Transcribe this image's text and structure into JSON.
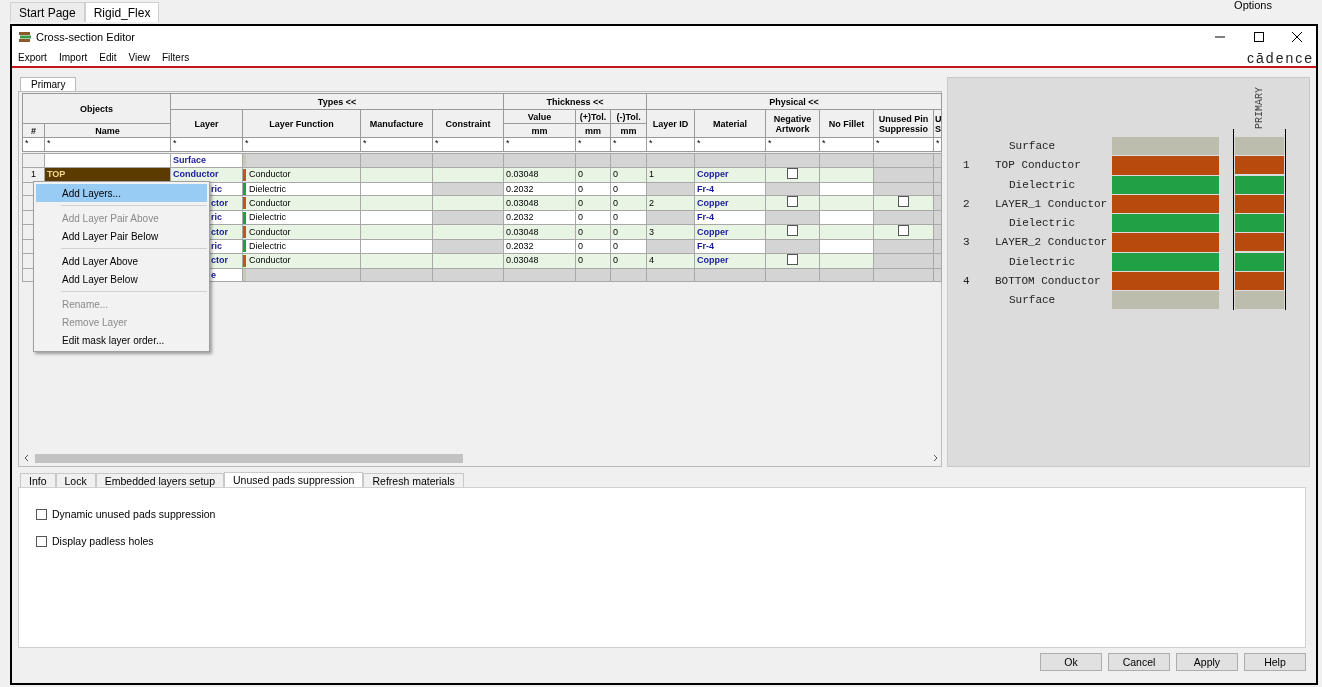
{
  "tab_strip": {
    "tabs": [
      {
        "label": "Start Page",
        "selected": false
      },
      {
        "label": "Rigid_Flex",
        "selected": true
      }
    ],
    "options_label": "Options"
  },
  "window": {
    "title": "Cross-section Editor",
    "logo": "cādence"
  },
  "menu_bar": [
    "Export",
    "Import",
    "Edit",
    "View",
    "Filters"
  ],
  "view_tabs": [
    {
      "label": "Primary",
      "selected": true
    }
  ],
  "table": {
    "groups": [
      {
        "label": "Objects",
        "kind": "tall",
        "columns": [
          {
            "label": "#",
            "filter": "*"
          },
          {
            "label": "Name",
            "filter": "*"
          }
        ]
      },
      {
        "label": "Types <<",
        "kind": "normal",
        "columns": [
          {
            "label": "Layer",
            "filter": "*"
          },
          {
            "label": "Layer Function",
            "filter": "*"
          },
          {
            "label": "Manufacture",
            "filter": "*"
          },
          {
            "label": "Constraint",
            "filter": "*"
          }
        ]
      },
      {
        "label": "Thickness <<",
        "kind": "normal",
        "columns": [
          {
            "label": "Value",
            "unit": "mm",
            "filter": "*"
          },
          {
            "label": "(+)Tol.",
            "unit": "mm",
            "filter": "*"
          },
          {
            "label": "(-)Tol.",
            "unit": "mm",
            "filter": "*"
          }
        ]
      },
      {
        "label": "Physical <<",
        "kind": "normal",
        "columns": [
          {
            "label": "Layer ID",
            "filter": "*"
          },
          {
            "label": "Material",
            "filter": "*"
          },
          {
            "label": "Negative Artwork",
            "filter": "*"
          },
          {
            "label": "No Fillet",
            "filter": "*"
          },
          {
            "label": "Unused Pin Suppressio",
            "filter": "*"
          },
          {
            "label": "U S",
            "filter": "*"
          }
        ]
      }
    ],
    "rows": [
      {
        "kind": "surface",
        "layer": "Surface",
        "color": "#c8c8bc"
      },
      {
        "kind": "conductor",
        "number": "1",
        "name": "TOP",
        "selected": true,
        "layer": "Conductor",
        "function": "Conductor",
        "color": "#c0561a",
        "value": "0.03048",
        "plus_tol": "0",
        "minus_tol": "0",
        "layer_id": "1",
        "material": "Copper",
        "negative_artwork": false
      },
      {
        "kind": "dielectric",
        "layer": "ric",
        "function": "Dielectric",
        "color": "#22a040",
        "value": "0.2032",
        "plus_tol": "0",
        "minus_tol": "0",
        "material": "Fr-4"
      },
      {
        "kind": "conductor",
        "layer": "ctor",
        "function": "Conductor",
        "color": "#c0561a",
        "value": "0.03048",
        "plus_tol": "0",
        "minus_tol": "0",
        "layer_id": "2",
        "material": "Copper",
        "negative_artwork": false,
        "unused_pin_suppression": false
      },
      {
        "kind": "dielectric",
        "layer": "ric",
        "function": "Dielectric",
        "color": "#22a040",
        "value": "0.2032",
        "plus_tol": "0",
        "minus_tol": "0",
        "material": "Fr-4"
      },
      {
        "kind": "conductor",
        "layer": "ctor",
        "function": "Conductor",
        "color": "#c0561a",
        "value": "0.03048",
        "plus_tol": "0",
        "minus_tol": "0",
        "layer_id": "3",
        "material": "Copper",
        "negative_artwork": false,
        "unused_pin_suppression": false
      },
      {
        "kind": "dielectric",
        "layer": "ric",
        "function": "Dielectric",
        "color": "#22a040",
        "value": "0.2032",
        "plus_tol": "0",
        "minus_tol": "0",
        "material": "Fr-4"
      },
      {
        "kind": "conductor",
        "layer": "ctor",
        "function": "Conductor",
        "color": "#c0561a",
        "value": "0.03048",
        "plus_tol": "0",
        "minus_tol": "0",
        "layer_id": "4",
        "material": "Copper",
        "negative_artwork": false
      },
      {
        "kind": "surface",
        "layer": "e",
        "color": "#c8c8bc"
      }
    ]
  },
  "context_menu": [
    {
      "kind": "item",
      "label": "Add Layers...",
      "highlighted": true,
      "disabled": false
    },
    {
      "kind": "separator"
    },
    {
      "kind": "item",
      "label": "Add Layer Pair Above",
      "highlighted": false,
      "disabled": true
    },
    {
      "kind": "item",
      "label": "Add Layer Pair Below",
      "highlighted": false,
      "disabled": false
    },
    {
      "kind": "separator"
    },
    {
      "kind": "item",
      "label": "Add Layer Above",
      "highlighted": false,
      "disabled": false
    },
    {
      "kind": "item",
      "label": "Add Layer Below",
      "highlighted": false,
      "disabled": false
    },
    {
      "kind": "separator"
    },
    {
      "kind": "item",
      "label": "Rename...",
      "highlighted": false,
      "disabled": true
    },
    {
      "kind": "item",
      "label": "Remove Layer",
      "highlighted": false,
      "disabled": true
    },
    {
      "kind": "item",
      "label": "Edit mask layer order...",
      "highlighted": false,
      "disabled": false
    }
  ],
  "stack": {
    "column_label": "PRIMARY",
    "layers": [
      {
        "kind": "surface",
        "label": "Surface",
        "color": "#bdbdad"
      },
      {
        "kind": "conductor",
        "number": "1",
        "label": "TOP Conductor",
        "color": "#b94a0e"
      },
      {
        "kind": "dielectric",
        "label": "Dielectric",
        "color": "#22a045"
      },
      {
        "kind": "conductor",
        "number": "2",
        "label": "LAYER_1 Conductor",
        "color": "#b94a0e"
      },
      {
        "kind": "dielectric",
        "label": "Dielectric",
        "color": "#22a045"
      },
      {
        "kind": "conductor",
        "number": "3",
        "label": "LAYER_2 Conductor",
        "color": "#b94a0e"
      },
      {
        "kind": "dielectric",
        "label": "Dielectric",
        "color": "#22a045"
      },
      {
        "kind": "conductor",
        "number": "4",
        "label": "BOTTOM Conductor",
        "color": "#b94a0e"
      },
      {
        "kind": "surface",
        "label": "Surface",
        "color": "#bdbdad"
      }
    ]
  },
  "bottom_tabs": [
    {
      "label": "Info",
      "selected": false
    },
    {
      "label": "Lock",
      "selected": false
    },
    {
      "label": "Embedded layers setup",
      "selected": false
    },
    {
      "label": "Unused pads suppression",
      "selected": true
    },
    {
      "label": "Refresh materials",
      "selected": false
    }
  ],
  "options": [
    {
      "label": "Dynamic unused pads suppression",
      "checked": false
    },
    {
      "label": "Display padless holes",
      "checked": false
    }
  ],
  "buttons": [
    "Ok",
    "Cancel",
    "Apply",
    "Help"
  ]
}
